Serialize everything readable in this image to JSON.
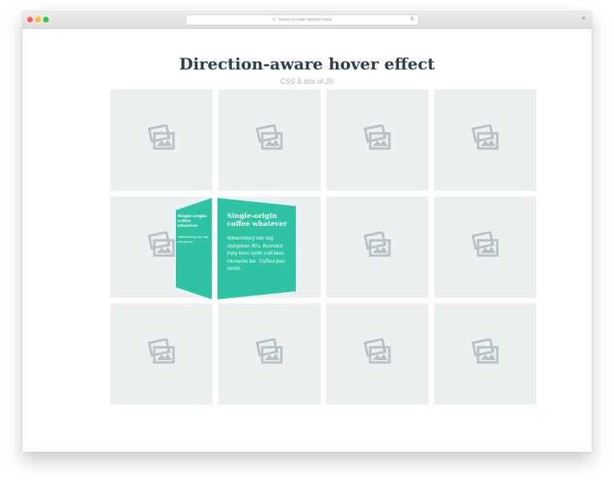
{
  "browser": {
    "address_placeholder": "Search or enter website name",
    "new_tab_label": "+"
  },
  "page": {
    "title": "Direction-aware hover effect",
    "subtitle": "CSS & bits of JS"
  },
  "grid": {
    "tiles": [
      {
        "id": 1
      },
      {
        "id": 2
      },
      {
        "id": 3
      },
      {
        "id": 4
      },
      {
        "id": 5
      },
      {
        "id": 6
      },
      {
        "id": 7
      },
      {
        "id": 8
      },
      {
        "id": 9
      },
      {
        "id": 10
      },
      {
        "id": 11
      },
      {
        "id": 12
      }
    ],
    "placeholder_icon": "image-placeholder-icon"
  },
  "hover_overlay": {
    "side_panel": {
      "title": "Single-origin coffee whatever",
      "text": "Williamsburg tote bag stumptown..."
    },
    "front_panel": {
      "title": "Single-origin coffee whatever",
      "text": "Williamsburg tote bag stumptown 90's. Bushwick irony lomo synth craft beer, mustache bar. Truffaut jean shorts."
    },
    "color": "#2ec3a3"
  },
  "colors": {
    "title": "#2f3e50",
    "subtitle": "#a9b2bb",
    "tile_bg": "#ecf0f1",
    "icon": "#b8c1c6"
  }
}
